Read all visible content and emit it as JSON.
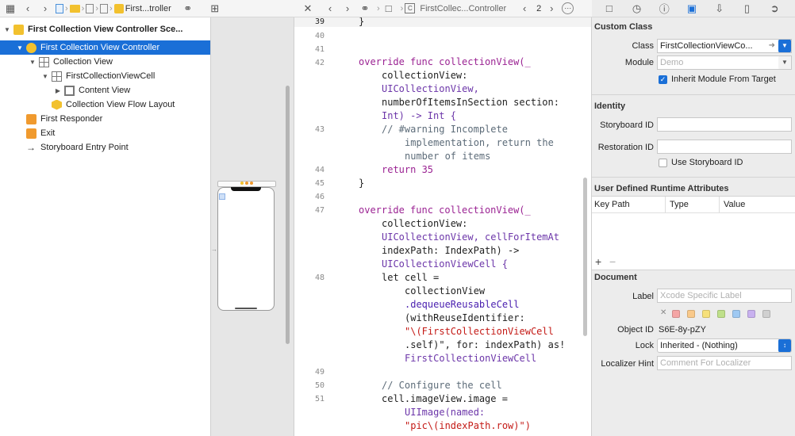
{
  "nav_left": {
    "breadcrumb_last": "First...troller"
  },
  "nav_code": {
    "breadcrumb": "FirstCollec...Controller",
    "counter": "2"
  },
  "outline": {
    "items": [
      {
        "label": "First Collection View Controller Sce..."
      },
      {
        "label": "First Collection View Controller"
      },
      {
        "label": "Collection View"
      },
      {
        "label": "FirstCollectionViewCell"
      },
      {
        "label": "Content View"
      },
      {
        "label": "Collection View Flow Layout"
      },
      {
        "label": "First Responder"
      },
      {
        "label": "Exit"
      },
      {
        "label": "Storyboard Entry Point"
      }
    ]
  },
  "code": {
    "line_numbers": [
      "39",
      "40",
      "41",
      "42",
      "43",
      "44",
      "45",
      "46",
      "47",
      "48",
      "49",
      "50",
      "51"
    ],
    "lines": [
      "}",
      "override func collectionView(_",
      "collectionView:",
      "UICollectionView,",
      "numberOfItemsInSection section:",
      "Int) -> Int {",
      "// #warning Incomplete",
      "implementation, return the",
      "number of items",
      "return 35",
      "}",
      "override func collectionView(_",
      "collectionView:",
      "UICollectionView, cellForItemAt",
      "indexPath: IndexPath) ->",
      "UICollectionViewCell {",
      "let cell =",
      "collectionView",
      ".dequeueReusableCell",
      "(withReuseIdentifier:",
      "\"\\(FirstCollectionViewCell",
      ".self)\", for: indexPath) as!",
      "FirstCollectionViewCell",
      "// Configure the cell",
      "cell.imageView.image =",
      "UIImage(named:",
      "\"pic\\(indexPath.row)\")"
    ]
  },
  "inspector": {
    "custom_class": {
      "title": "Custom Class",
      "class_label": "Class",
      "class_value": "FirstCollectionViewCo...",
      "module_label": "Module",
      "module_placeholder": "Demo",
      "inherit_label": "Inherit Module From Target"
    },
    "identity": {
      "title": "Identity",
      "storyboard_id_label": "Storyboard ID",
      "restoration_id_label": "Restoration ID",
      "use_storyboard_id_label": "Use Storyboard ID"
    },
    "runtime_attrs": {
      "title": "User Defined Runtime Attributes",
      "columns": [
        "Key Path",
        "Type",
        "Value"
      ],
      "add": "+",
      "remove": "−"
    },
    "document": {
      "title": "Document",
      "label_label": "Label",
      "label_placeholder": "Xcode Specific Label",
      "object_id_label": "Object ID",
      "object_id_value": "S6E-8y-pZY",
      "lock_label": "Lock",
      "lock_value": "Inherited - (Nothing)",
      "localizer_label": "Localizer Hint",
      "localizer_placeholder": "Comment For Localizer",
      "swatch_colors": [
        "#f4a5a5",
        "#f9c98a",
        "#f6e07a",
        "#bfe08a",
        "#9fc9f2",
        "#c8b1ef",
        "#d0d0d0"
      ]
    }
  }
}
